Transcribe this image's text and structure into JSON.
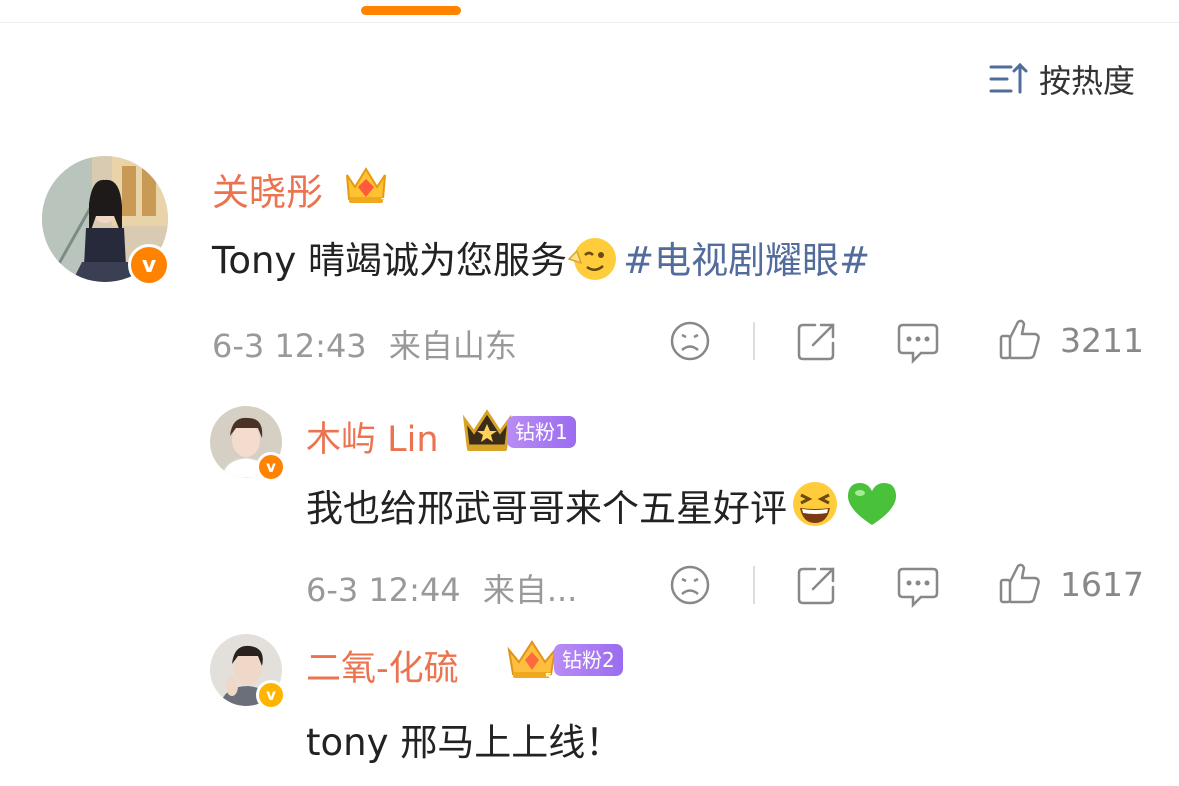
{
  "sort": {
    "label": "按热度",
    "icon": "sort-icon"
  },
  "colors": {
    "accent": "#ff8200",
    "username": "#eb7350",
    "hashtag": "#526c9b",
    "fan_badge": "#a67cf2"
  },
  "comment": {
    "username": "关晓彤",
    "text_before": "Tony 晴竭诚为您服务",
    "emoji": "wink-smile-emoji",
    "hashtag": "#电视剧耀眼#",
    "time": "6-3 12:43",
    "location": "来自山东",
    "likes": "3211",
    "verified_icon": "v",
    "replies": [
      {
        "username": "木屿 Lin",
        "fan_badge": "钻粉1",
        "text": "我也给邢武哥哥来个五星好评",
        "emojis": [
          "grinning-squint-emoji",
          "green-heart-emoji"
        ],
        "time": "6-3 12:44",
        "location": "来自...",
        "likes": "1617"
      },
      {
        "username": "二氧-化硫",
        "fan_badge": "钻粉2",
        "text": "tony 邢马上上线！"
      }
    ]
  }
}
